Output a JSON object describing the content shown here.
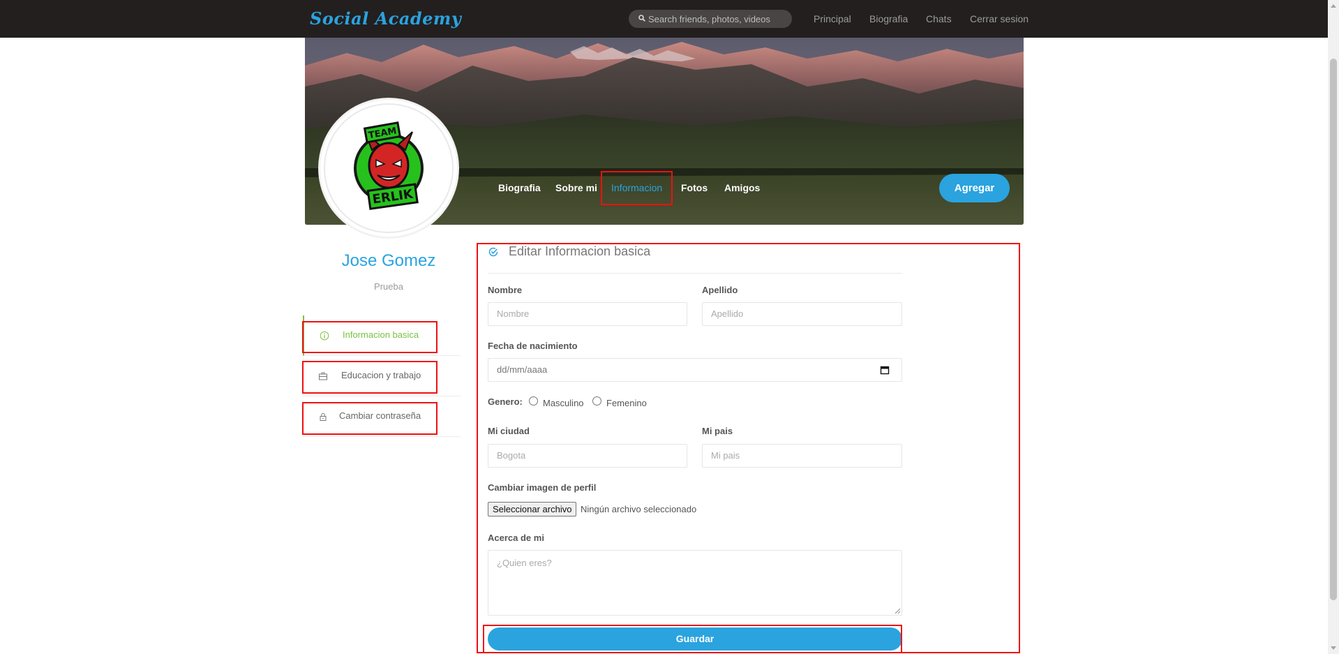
{
  "navbar": {
    "brand": "Social Academy",
    "search_placeholder": "Search friends, photos, videos",
    "links": [
      "Principal",
      "Biografia",
      "Chats",
      "Cerrar sesion"
    ]
  },
  "cover": {
    "tabs": [
      "Biografia",
      "Sobre mi",
      "Informacion",
      "Fotos",
      "Amigos"
    ],
    "active_tab": "Informacion",
    "add_button": "Agregar",
    "avatar_text_top": "TEAM",
    "avatar_text_bottom": "ERLIK"
  },
  "profile": {
    "name": "Jose Gomez",
    "subtitle": "Prueba"
  },
  "sidebar": {
    "items": [
      {
        "label": "Informacion basica",
        "icon": "info-icon",
        "active": true
      },
      {
        "label": "Educacion y trabajo",
        "icon": "briefcase-icon",
        "active": false
      },
      {
        "label": "Cambiar contraseña",
        "icon": "lock-icon",
        "active": false
      }
    ]
  },
  "form": {
    "title": "Editar Informacion basica",
    "first_name_label": "Nombre",
    "first_name_placeholder": "Nombre",
    "last_name_label": "Apellido",
    "last_name_placeholder": "Apellido",
    "birthdate_label": "Fecha de nacimiento",
    "birthdate_placeholder": "dd/mm/aaaa",
    "gender_label": "Genero:",
    "gender_options": [
      "Masculino",
      "Femenino"
    ],
    "city_label": "Mi ciudad",
    "city_placeholder": "Bogota",
    "country_label": "Mi pais",
    "country_placeholder": "Mi pais",
    "profile_image_label": "Cambiar imagen de perfil",
    "file_button": "Seleccionar archivo",
    "file_status": "Ningún archivo seleccionado",
    "about_label": "Acerca de mi",
    "about_placeholder": "¿Quien eres?",
    "submit": "Guardar"
  },
  "colors": {
    "navbar_bg": "#231f1f",
    "accent": "#2aa3df",
    "active_green": "#7bc143",
    "annotation_red": "#ee1111"
  }
}
